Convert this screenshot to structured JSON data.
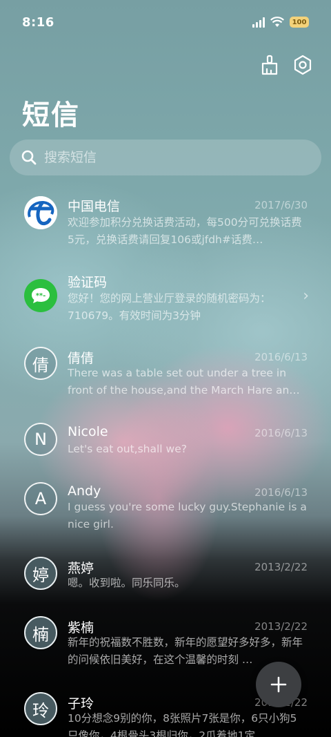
{
  "status": {
    "time": "8:16",
    "battery": "100"
  },
  "header": {
    "title": "短信"
  },
  "search": {
    "placeholder": "搜索短信"
  },
  "conversations": [
    {
      "name": "中国电信",
      "date": "2017/6/30",
      "preview": "欢迎参加积分兑换话费活动，每500分可兑换话费5元，兑换话费请回复106或jfdh#话费…",
      "avatar": "china-telecom-logo"
    },
    {
      "name": "验证码",
      "date": "",
      "preview": "您好！您的网上营业厅登录的随机密码为：710679。有效时间为3分钟",
      "avatar": "message-bubble-icon"
    },
    {
      "name": "倩倩",
      "date": "2016/6/13",
      "preview": "There was a table set out under a tree in front of the house,and the March Hare an…",
      "avatar_text": "倩"
    },
    {
      "name": "Nicole",
      "date": "2016/6/13",
      "preview": "Let's eat out,shall we?",
      "avatar_text": "N"
    },
    {
      "name": "Andy",
      "date": "2016/6/13",
      "preview": "I guess you're some lucky guy.Stephanie is a nice girl.",
      "avatar_text": "A"
    },
    {
      "name": "燕婷",
      "date": "2013/2/22",
      "preview": "嗯。收到啦。同乐同乐。",
      "avatar_text": "婷"
    },
    {
      "name": "紫楠",
      "date": "2013/2/22",
      "preview": "新年的祝福数不胜数，新年的愿望好多好多，新年的问候依旧美好，在这个温馨的时刻 …",
      "avatar_text": "楠"
    },
    {
      "name": "子玲",
      "date": "2013/2/22",
      "preview": "10分想念9别的你，8张照片7张是你，6只小狗5只像你，4根骨头3根归你，2爪着地1定",
      "avatar_text": "玲"
    }
  ],
  "colors": {
    "telecom_blue": "#1565c0",
    "wechat_green": "#2bbf3f",
    "battery": "#f3d27a"
  }
}
